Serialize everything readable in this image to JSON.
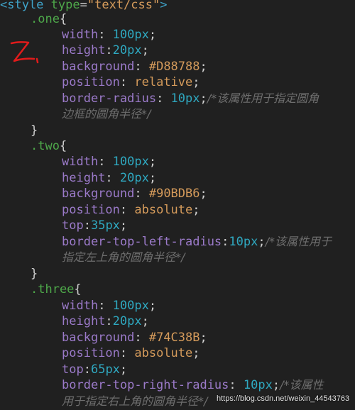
{
  "code": {
    "style_open": {
      "tag_open": "<style",
      "attr": "type",
      "eq": "=",
      "value": "\"text/css\"",
      "tag_close": ">"
    },
    "rules": [
      {
        "selector": ".one",
        "declarations": [
          {
            "prop": "width",
            "sep": ": ",
            "value": "100px",
            "type": "num"
          },
          {
            "prop": "height",
            "sep": ":",
            "value": "20px",
            "type": "num"
          },
          {
            "prop": "background",
            "sep": ": ",
            "value": "#D88788",
            "type": "hex"
          },
          {
            "prop": "position",
            "sep": ": ",
            "value": "relative",
            "type": "kw"
          },
          {
            "prop": "border-radius",
            "sep": ": ",
            "value": "10px",
            "type": "num",
            "comment_line1": "/*该属性用于指定圆角",
            "comment_line2": "边框的圆角半径*/"
          }
        ]
      },
      {
        "selector": ".two",
        "declarations": [
          {
            "prop": "width",
            "sep": ": ",
            "value": "100px",
            "type": "num"
          },
          {
            "prop": "height",
            "sep": ": ",
            "value": "20px",
            "type": "num"
          },
          {
            "prop": "background",
            "sep": ": ",
            "value": "#90BDB6",
            "type": "hex"
          },
          {
            "prop": "position",
            "sep": ": ",
            "value": "absolute",
            "type": "kw"
          },
          {
            "prop": "top",
            "sep": ":",
            "value": "35px",
            "type": "num"
          },
          {
            "prop": "border-top-left-radius",
            "sep": ":",
            "value": "10px",
            "type": "num",
            "comment_line1": "/*该属性用于",
            "comment_line2": "指定左上角的圆角半径*/"
          }
        ]
      },
      {
        "selector": ".three",
        "declarations": [
          {
            "prop": "width",
            "sep": ": ",
            "value": "100px",
            "type": "num"
          },
          {
            "prop": "height",
            "sep": ":",
            "value": "20px",
            "type": "num"
          },
          {
            "prop": "background",
            "sep": ": ",
            "value": "#74C38B",
            "type": "hex"
          },
          {
            "prop": "position",
            "sep": ": ",
            "value": "absolute",
            "type": "kw"
          },
          {
            "prop": "top",
            "sep": ":",
            "value": "65px",
            "type": "num"
          },
          {
            "prop": "border-top-right-radius",
            "sep": ": ",
            "value": "10px",
            "type": "num",
            "comment_line1": "/*该属性",
            "comment_line2": "用于指定右上角的圆角半径*/"
          }
        ]
      }
    ],
    "open_brace": "{",
    "close_brace": "}",
    "semicolon": ";"
  },
  "annotation": {
    "text": "2.",
    "color": "#e01b1b"
  },
  "watermark": "https://blog.csdn.net/weixin_44543763",
  "colors": {
    "background": "#202020",
    "tag": "#3fa3c9",
    "selector": "#4ea84a",
    "property": "#9b7ac9",
    "number": "#2fa8c0",
    "string": "#d59b5b",
    "comment": "#6e6e6e"
  }
}
